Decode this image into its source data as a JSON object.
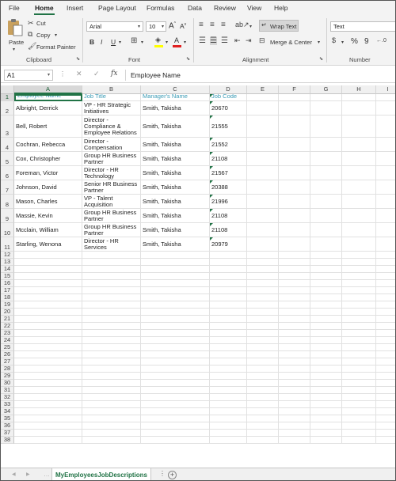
{
  "menu_tabs": [
    "File",
    "Home",
    "Insert",
    "Page Layout",
    "Formulas",
    "Data",
    "Review",
    "View",
    "Help"
  ],
  "active_tab": "Home",
  "clipboard": {
    "paste": "Paste",
    "cut": "Cut",
    "copy": "Copy",
    "format_painter": "Format Painter",
    "label": "Clipboard"
  },
  "font": {
    "name": "Arial",
    "size": "10",
    "bold": "B",
    "italic": "I",
    "underline": "U",
    "label": "Font"
  },
  "alignment": {
    "wrap_text": "Wrap Text",
    "merge_center": "Merge & Center",
    "label": "Alignment"
  },
  "number": {
    "format": "Text",
    "percent": "%",
    "comma": "9",
    "label": "Number"
  },
  "formula_bar": {
    "name_box": "A1",
    "fx": "fx",
    "content": "Employee Name"
  },
  "columns": [
    "A",
    "B",
    "C",
    "D",
    "E",
    "F",
    "G",
    "H",
    "I"
  ],
  "headers": [
    "Employee Name",
    "Job Title",
    "Manager's Name",
    "Job Code"
  ],
  "rows": [
    {
      "name": "Albright, Derrick",
      "title": "VP - HR Strategic Initiatives",
      "manager": "Smith, Takisha",
      "code": "20670"
    },
    {
      "name": "Bell, Robert",
      "title": "Director - Compliance & Employee Relations",
      "manager": "Smith, Takisha",
      "code": "21555"
    },
    {
      "name": "Cochran, Rebecca",
      "title": "Director - Compensation",
      "manager": "Smith, Takisha",
      "code": "21552"
    },
    {
      "name": "Cox, Christopher",
      "title": "Group HR Business Partner",
      "manager": "Smith, Takisha",
      "code": "21108"
    },
    {
      "name": "Foreman, Victor",
      "title": "Director - HR Technology",
      "manager": "Smith, Takisha",
      "code": "21567"
    },
    {
      "name": "Johnson, David",
      "title": "Senior HR Business Partner",
      "manager": "Smith, Takisha",
      "code": "20388"
    },
    {
      "name": "Mason, Charles",
      "title": "VP - Talent Acquisition",
      "manager": "Smith, Takisha",
      "code": "21996"
    },
    {
      "name": "Massie, Kevin",
      "title": "Group HR Business Partner",
      "manager": "Smith, Takisha",
      "code": "21108"
    },
    {
      "name": "Mcclain, William",
      "title": "Group HR Business Partner",
      "manager": "Smith, Takisha",
      "code": "21108"
    },
    {
      "name": "Starling, Wenona",
      "title": "Director - HR Services",
      "manager": "Smith, Takisha",
      "code": "20979"
    }
  ],
  "total_rows": 38,
  "sheet_tab": "MyEmployeesJobDescriptions",
  "add_sheet": "+",
  "colors": {
    "accent": "#217346",
    "header_text": "#3b9cb6"
  }
}
